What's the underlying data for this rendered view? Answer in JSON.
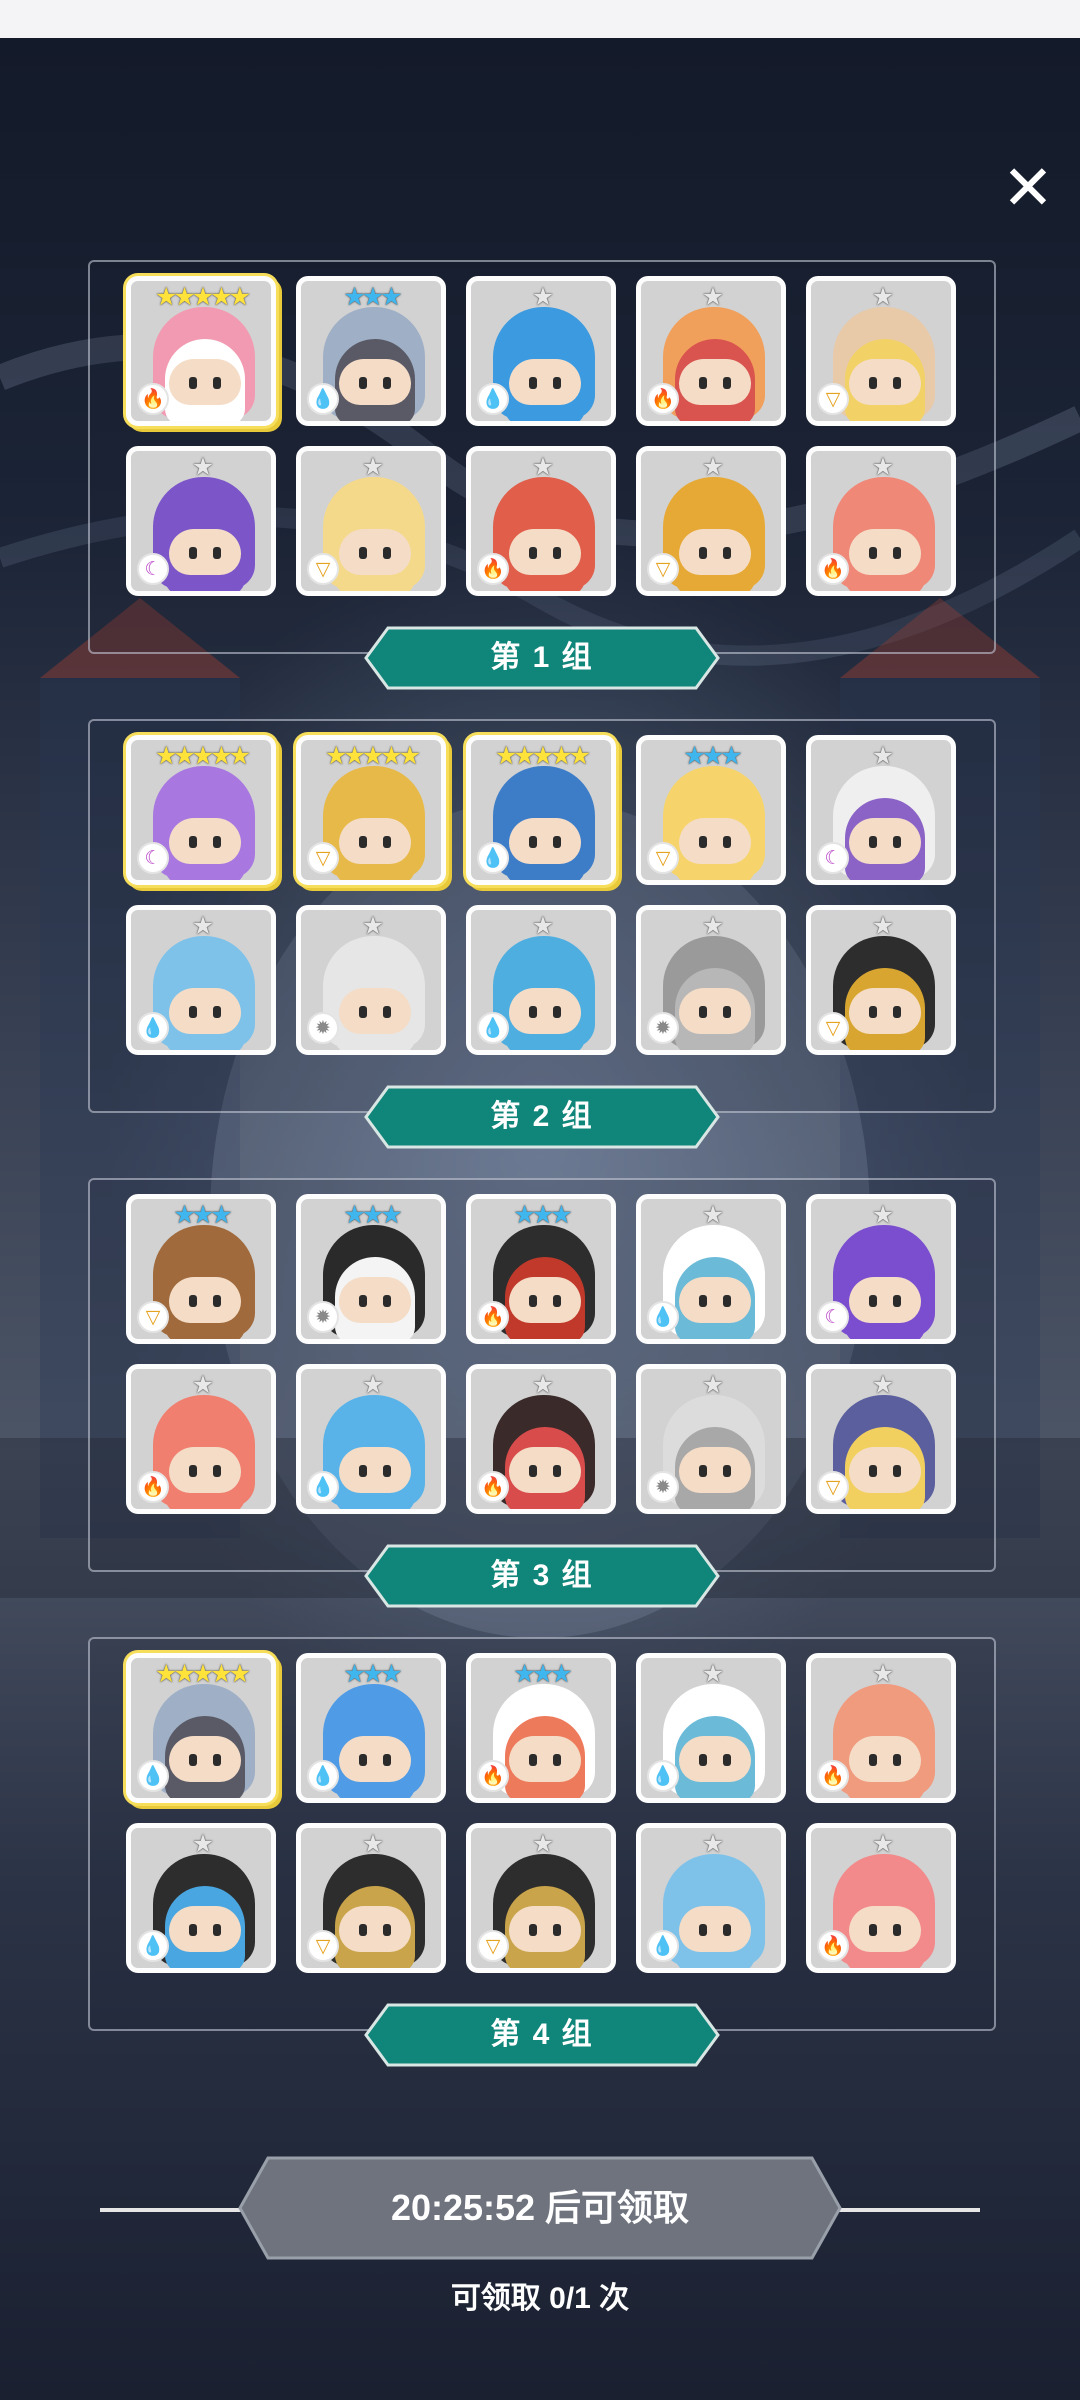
{
  "close_icon": "close-icon",
  "groups": [
    {
      "label": "第 1 组",
      "cards": [
        {
          "stars": "★★★★★",
          "rarity": "five",
          "element": "fire",
          "portrait": "#ffffff",
          "hair": "#f29ab1"
        },
        {
          "stars": "★★★",
          "rarity": "three",
          "element": "water",
          "portrait": "#5a5a66",
          "hair": "#9fb0c6"
        },
        {
          "stars": "★",
          "rarity": "one",
          "element": "water",
          "portrait": "#3b9ae0",
          "hair": "#3b9ae0"
        },
        {
          "stars": "★",
          "rarity": "one",
          "element": "fire",
          "portrait": "#d9534f",
          "hair": "#f0a05b"
        },
        {
          "stars": "★",
          "rarity": "one",
          "element": "wind",
          "portrait": "#f2d266",
          "hair": "#e8c9a8"
        },
        {
          "stars": "★",
          "rarity": "one",
          "element": "dark",
          "portrait": "#7c56c9",
          "hair": "#7c56c9"
        },
        {
          "stars": "★",
          "rarity": "one",
          "element": "wind",
          "portrait": "#f5d98a",
          "hair": "#f5d98a"
        },
        {
          "stars": "★",
          "rarity": "one",
          "element": "fire",
          "portrait": "#e05e4a",
          "hair": "#e05e4a"
        },
        {
          "stars": "★",
          "rarity": "one",
          "element": "wind",
          "portrait": "#e7a935",
          "hair": "#e7a935"
        },
        {
          "stars": "★",
          "rarity": "one",
          "element": "fire",
          "portrait": "#f08878",
          "hair": "#f08878"
        }
      ]
    },
    {
      "label": "第 2 组",
      "cards": [
        {
          "stars": "★★★★★",
          "rarity": "five",
          "element": "dark",
          "portrait": "#a878e0",
          "hair": "#a878e0"
        },
        {
          "stars": "★★★★★",
          "rarity": "five",
          "element": "wind",
          "portrait": "#e7b948",
          "hair": "#e7b948"
        },
        {
          "stars": "★★★★★",
          "rarity": "five",
          "element": "water",
          "portrait": "#3d7dc8",
          "hair": "#3d7dc8"
        },
        {
          "stars": "★★★",
          "rarity": "three",
          "element": "wind",
          "portrait": "#f6d46b",
          "hair": "#f6d46b"
        },
        {
          "stars": "★",
          "rarity": "one",
          "element": "dark",
          "portrait": "#8b63c7",
          "hair": "#efefef"
        },
        {
          "stars": "★",
          "rarity": "one",
          "element": "water",
          "portrait": "#7ec2ea",
          "hair": "#7ec2ea"
        },
        {
          "stars": "★",
          "rarity": "one",
          "element": "light",
          "portrait": "#e6e6e6",
          "hair": "#e6e6e6"
        },
        {
          "stars": "★",
          "rarity": "one",
          "element": "water",
          "portrait": "#4faee0",
          "hair": "#4faee0"
        },
        {
          "stars": "★",
          "rarity": "one",
          "element": "light",
          "portrait": "#b7b7b7",
          "hair": "#9a9a9a"
        },
        {
          "stars": "★",
          "rarity": "one",
          "element": "wind",
          "portrait": "#d8a630",
          "hair": "#2d2d2d"
        }
      ]
    },
    {
      "label": "第 3 组",
      "cards": [
        {
          "stars": "★★★",
          "rarity": "three",
          "element": "wind",
          "portrait": "#a06a3c",
          "hair": "#a06a3c"
        },
        {
          "stars": "★★★",
          "rarity": "three",
          "element": "light",
          "portrait": "#f4f4f4",
          "hair": "#2a2a2a"
        },
        {
          "stars": "★★★",
          "rarity": "three",
          "element": "fire",
          "portrait": "#c0392b",
          "hair": "#2d2d2d"
        },
        {
          "stars": "★",
          "rarity": "one",
          "element": "water",
          "portrait": "#6bbad8",
          "hair": "#ffffff"
        },
        {
          "stars": "★",
          "rarity": "one",
          "element": "dark",
          "portrait": "#7b4ed0",
          "hair": "#7b4ed0"
        },
        {
          "stars": "★",
          "rarity": "one",
          "element": "fire",
          "portrait": "#f07f70",
          "hair": "#f07f70"
        },
        {
          "stars": "★",
          "rarity": "one",
          "element": "water",
          "portrait": "#59b3e8",
          "hair": "#59b3e8"
        },
        {
          "stars": "★",
          "rarity": "one",
          "element": "fire",
          "portrait": "#d94c4c",
          "hair": "#3a2a2a"
        },
        {
          "stars": "★",
          "rarity": "one",
          "element": "light",
          "portrait": "#a8a8a8",
          "hair": "#dcdcdc"
        },
        {
          "stars": "★",
          "rarity": "one",
          "element": "wind",
          "portrait": "#f2d060",
          "hair": "#5b5f9e"
        }
      ]
    },
    {
      "label": "第 4 组",
      "cards": [
        {
          "stars": "★★★★★",
          "rarity": "five",
          "element": "water",
          "portrait": "#5a5a66",
          "hair": "#9fb0c6"
        },
        {
          "stars": "★★★",
          "rarity": "three",
          "element": "water",
          "portrait": "#4f9be6",
          "hair": "#4f9be6"
        },
        {
          "stars": "★★★",
          "rarity": "three",
          "element": "fire",
          "portrait": "#ee7a5c",
          "hair": "#ffffff"
        },
        {
          "stars": "★",
          "rarity": "one",
          "element": "water",
          "portrait": "#6bbad8",
          "hair": "#ffffff"
        },
        {
          "stars": "★",
          "rarity": "one",
          "element": "fire",
          "portrait": "#f09a7e",
          "hair": "#f09a7e"
        },
        {
          "stars": "★",
          "rarity": "one",
          "element": "water",
          "portrait": "#4aa6e0",
          "hair": "#2d2d2d"
        },
        {
          "stars": "★",
          "rarity": "one",
          "element": "wind",
          "portrait": "#c9a44a",
          "hair": "#2d2d2d"
        },
        {
          "stars": "★",
          "rarity": "one",
          "element": "wind",
          "portrait": "#c9a44a",
          "hair": "#2d2d2d"
        },
        {
          "stars": "★",
          "rarity": "one",
          "element": "water",
          "portrait": "#7ec2ea",
          "hair": "#7ec2ea"
        },
        {
          "stars": "★",
          "rarity": "one",
          "element": "fire",
          "portrait": "#f2898a",
          "hair": "#f2898a"
        }
      ]
    }
  ],
  "element_icons": {
    "fire": "🔥",
    "water": "💧",
    "wind": "▽",
    "dark": "☾",
    "light": "✹"
  },
  "claim": {
    "button_label": "20:25:52 后可领取",
    "count_text": "可领取 0/1 次"
  },
  "colors": {
    "group_label_bg": "#10857a",
    "claim_button_bg": "#6e737e"
  }
}
